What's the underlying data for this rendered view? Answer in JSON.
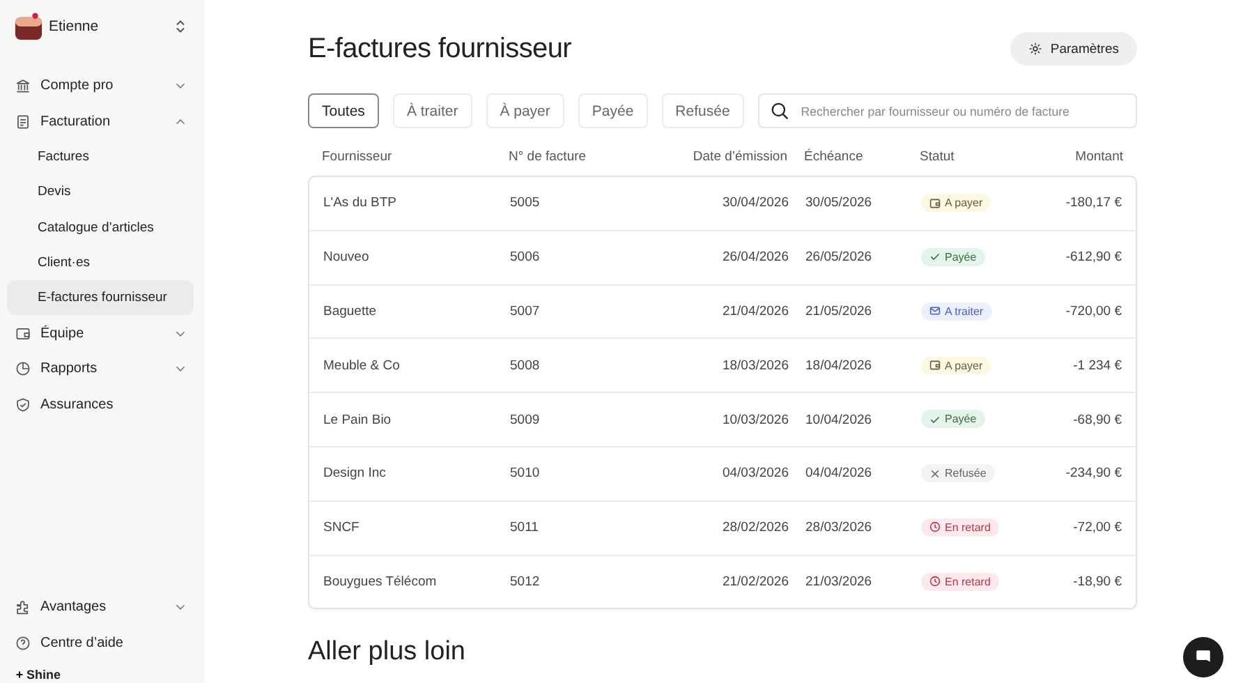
{
  "account": {
    "name": "Etienne"
  },
  "sidebar": {
    "items": [
      {
        "label": "Compte pro",
        "expanded": false,
        "selected": false
      },
      {
        "label": "Facturation",
        "expanded": true,
        "selected": false,
        "children": [
          {
            "label": "Factures",
            "selected": false
          },
          {
            "label": "Devis",
            "selected": false
          },
          {
            "label": "Catalogue d’articles",
            "selected": false
          },
          {
            "label": "Client·es",
            "selected": false
          },
          {
            "label": "E-factures fournisseur",
            "selected": true
          }
        ]
      },
      {
        "label": "Équipe",
        "expanded": false,
        "selected": false
      },
      {
        "label": "Rapports",
        "expanded": false,
        "selected": false
      },
      {
        "label": "Assurances",
        "selected": false
      }
    ],
    "bottom_items": [
      {
        "label": "Avantages",
        "expanded": false
      },
      {
        "label": "Centre d’aide"
      }
    ],
    "brand": "Shine"
  },
  "page": {
    "title": "E-factures fournisseur",
    "settings_button": "Paramètres"
  },
  "filters": [
    {
      "label": "Toutes",
      "selected": true
    },
    {
      "label": "À traiter",
      "selected": false
    },
    {
      "label": "À payer",
      "selected": false
    },
    {
      "label": "Payée",
      "selected": false
    },
    {
      "label": "Refusée",
      "selected": false
    }
  ],
  "search": {
    "placeholder": "Rechercher par fournisseur ou numéro de facture"
  },
  "table": {
    "columns": [
      "Fournisseur",
      "N° de facture",
      "Date d’émission",
      "Échéance",
      "Statut",
      "Montant"
    ],
    "rows": [
      {
        "supplier": "L'As du BTP",
        "number": "5005",
        "issued": "30/04/2026",
        "due": "30/05/2026",
        "status": {
          "kind": "to_pay",
          "label": "A payer"
        },
        "amount": "-180,17 €"
      },
      {
        "supplier": "Nouveo",
        "number": "5006",
        "issued": "26/04/2026",
        "due": "26/05/2026",
        "status": {
          "kind": "paid",
          "label": "Payée"
        },
        "amount": "-612,90 €"
      },
      {
        "supplier": "Baguette",
        "number": "5007",
        "issued": "21/04/2026",
        "due": "21/05/2026",
        "status": {
          "kind": "to_process",
          "label": "A traiter"
        },
        "amount": "-720,00 €"
      },
      {
        "supplier": "Meuble & Co",
        "number": "5008",
        "issued": "18/03/2026",
        "due": "18/04/2026",
        "status": {
          "kind": "to_pay",
          "label": "A payer"
        },
        "amount": "-1 234 €"
      },
      {
        "supplier": "Le Pain Bio",
        "number": "5009",
        "issued": "10/03/2026",
        "due": "10/04/2026",
        "status": {
          "kind": "paid",
          "label": "Payée"
        },
        "amount": "-68,90 €"
      },
      {
        "supplier": "Design Inc",
        "number": "5010",
        "issued": "04/03/2026",
        "due": "04/04/2026",
        "status": {
          "kind": "refused",
          "label": "Refusée"
        },
        "amount": "-234,90 €"
      },
      {
        "supplier": "SNCF",
        "number": "5011",
        "issued": "28/02/2026",
        "due": "28/03/2026",
        "status": {
          "kind": "late",
          "label": "En retard"
        },
        "amount": "-72,00 €"
      },
      {
        "supplier": "Bouygues Télécom",
        "number": "5012",
        "issued": "21/02/2026",
        "due": "21/03/2026",
        "status": {
          "kind": "late",
          "label": "En retard"
        },
        "amount": "-18,90 €"
      }
    ]
  },
  "section_title": "Aller plus loin"
}
